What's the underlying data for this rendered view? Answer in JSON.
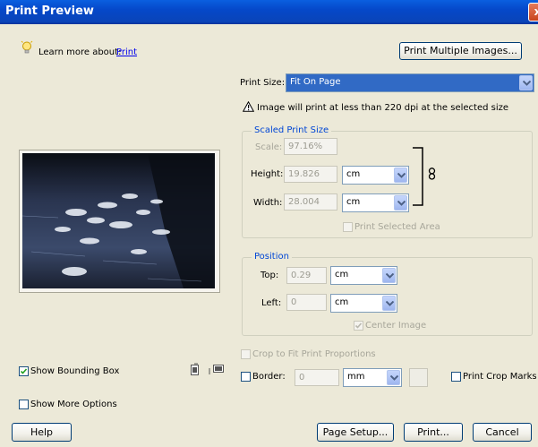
{
  "window": {
    "title": "Print Preview",
    "close_label": "x"
  },
  "learn_more": {
    "label": "Learn more about:",
    "link": "Print"
  },
  "buttons": {
    "print_multiple": "Print Multiple Images...",
    "help": "Help",
    "page_setup": "Page Setup...",
    "print": "Print...",
    "cancel": "Cancel"
  },
  "print_size": {
    "label": "Print Size:",
    "value": "Fit On Page"
  },
  "warning": "Image will print at less than 220 dpi at the selected size",
  "scaled": {
    "title": "Scaled Print Size",
    "scale_label": "Scale:",
    "scale_value": "97.16%",
    "height_label": "Height:",
    "height_value": "19.826",
    "height_unit": "cm",
    "width_label": "Width:",
    "width_value": "28.004",
    "width_unit": "cm",
    "print_selected": "Print Selected Area"
  },
  "position": {
    "title": "Position",
    "top_label": "Top:",
    "top_value": "0.29",
    "top_unit": "cm",
    "left_label": "Left:",
    "left_value": "0",
    "left_unit": "cm",
    "center_image": "Center Image"
  },
  "crop_fit": "Crop to Fit Print Proportions",
  "border": {
    "label": "Border:",
    "value": "0",
    "unit": "mm"
  },
  "print_crop_marks": "Print Crop Marks",
  "show_bounding_box": "Show Bounding Box",
  "show_more_options": "Show More Options",
  "colors": {
    "title_bar": "#0548c9",
    "dialog_bg": "#ece9d8",
    "group_title": "#0046d5",
    "selection": "#316ac5"
  }
}
